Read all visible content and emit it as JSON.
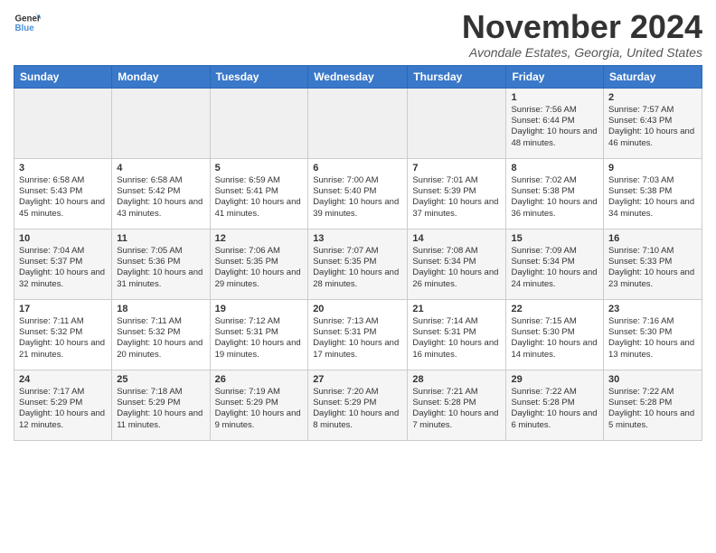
{
  "logo": {
    "line1": "General",
    "line2": "Blue"
  },
  "title": "November 2024",
  "location": "Avondale Estates, Georgia, United States",
  "days_header": [
    "Sunday",
    "Monday",
    "Tuesday",
    "Wednesday",
    "Thursday",
    "Friday",
    "Saturday"
  ],
  "weeks": [
    [
      {
        "day": "",
        "sunrise": "",
        "sunset": "",
        "daylight": ""
      },
      {
        "day": "",
        "sunrise": "",
        "sunset": "",
        "daylight": ""
      },
      {
        "day": "",
        "sunrise": "",
        "sunset": "",
        "daylight": ""
      },
      {
        "day": "",
        "sunrise": "",
        "sunset": "",
        "daylight": ""
      },
      {
        "day": "",
        "sunrise": "",
        "sunset": "",
        "daylight": ""
      },
      {
        "day": "1",
        "sunrise": "Sunrise: 7:56 AM",
        "sunset": "Sunset: 6:44 PM",
        "daylight": "Daylight: 10 hours and 48 minutes."
      },
      {
        "day": "2",
        "sunrise": "Sunrise: 7:57 AM",
        "sunset": "Sunset: 6:43 PM",
        "daylight": "Daylight: 10 hours and 46 minutes."
      }
    ],
    [
      {
        "day": "3",
        "sunrise": "Sunrise: 6:58 AM",
        "sunset": "Sunset: 5:43 PM",
        "daylight": "Daylight: 10 hours and 45 minutes."
      },
      {
        "day": "4",
        "sunrise": "Sunrise: 6:58 AM",
        "sunset": "Sunset: 5:42 PM",
        "daylight": "Daylight: 10 hours and 43 minutes."
      },
      {
        "day": "5",
        "sunrise": "Sunrise: 6:59 AM",
        "sunset": "Sunset: 5:41 PM",
        "daylight": "Daylight: 10 hours and 41 minutes."
      },
      {
        "day": "6",
        "sunrise": "Sunrise: 7:00 AM",
        "sunset": "Sunset: 5:40 PM",
        "daylight": "Daylight: 10 hours and 39 minutes."
      },
      {
        "day": "7",
        "sunrise": "Sunrise: 7:01 AM",
        "sunset": "Sunset: 5:39 PM",
        "daylight": "Daylight: 10 hours and 37 minutes."
      },
      {
        "day": "8",
        "sunrise": "Sunrise: 7:02 AM",
        "sunset": "Sunset: 5:38 PM",
        "daylight": "Daylight: 10 hours and 36 minutes."
      },
      {
        "day": "9",
        "sunrise": "Sunrise: 7:03 AM",
        "sunset": "Sunset: 5:38 PM",
        "daylight": "Daylight: 10 hours and 34 minutes."
      }
    ],
    [
      {
        "day": "10",
        "sunrise": "Sunrise: 7:04 AM",
        "sunset": "Sunset: 5:37 PM",
        "daylight": "Daylight: 10 hours and 32 minutes."
      },
      {
        "day": "11",
        "sunrise": "Sunrise: 7:05 AM",
        "sunset": "Sunset: 5:36 PM",
        "daylight": "Daylight: 10 hours and 31 minutes."
      },
      {
        "day": "12",
        "sunrise": "Sunrise: 7:06 AM",
        "sunset": "Sunset: 5:35 PM",
        "daylight": "Daylight: 10 hours and 29 minutes."
      },
      {
        "day": "13",
        "sunrise": "Sunrise: 7:07 AM",
        "sunset": "Sunset: 5:35 PM",
        "daylight": "Daylight: 10 hours and 28 minutes."
      },
      {
        "day": "14",
        "sunrise": "Sunrise: 7:08 AM",
        "sunset": "Sunset: 5:34 PM",
        "daylight": "Daylight: 10 hours and 26 minutes."
      },
      {
        "day": "15",
        "sunrise": "Sunrise: 7:09 AM",
        "sunset": "Sunset: 5:34 PM",
        "daylight": "Daylight: 10 hours and 24 minutes."
      },
      {
        "day": "16",
        "sunrise": "Sunrise: 7:10 AM",
        "sunset": "Sunset: 5:33 PM",
        "daylight": "Daylight: 10 hours and 23 minutes."
      }
    ],
    [
      {
        "day": "17",
        "sunrise": "Sunrise: 7:11 AM",
        "sunset": "Sunset: 5:32 PM",
        "daylight": "Daylight: 10 hours and 21 minutes."
      },
      {
        "day": "18",
        "sunrise": "Sunrise: 7:11 AM",
        "sunset": "Sunset: 5:32 PM",
        "daylight": "Daylight: 10 hours and 20 minutes."
      },
      {
        "day": "19",
        "sunrise": "Sunrise: 7:12 AM",
        "sunset": "Sunset: 5:31 PM",
        "daylight": "Daylight: 10 hours and 19 minutes."
      },
      {
        "day": "20",
        "sunrise": "Sunrise: 7:13 AM",
        "sunset": "Sunset: 5:31 PM",
        "daylight": "Daylight: 10 hours and 17 minutes."
      },
      {
        "day": "21",
        "sunrise": "Sunrise: 7:14 AM",
        "sunset": "Sunset: 5:31 PM",
        "daylight": "Daylight: 10 hours and 16 minutes."
      },
      {
        "day": "22",
        "sunrise": "Sunrise: 7:15 AM",
        "sunset": "Sunset: 5:30 PM",
        "daylight": "Daylight: 10 hours and 14 minutes."
      },
      {
        "day": "23",
        "sunrise": "Sunrise: 7:16 AM",
        "sunset": "Sunset: 5:30 PM",
        "daylight": "Daylight: 10 hours and 13 minutes."
      }
    ],
    [
      {
        "day": "24",
        "sunrise": "Sunrise: 7:17 AM",
        "sunset": "Sunset: 5:29 PM",
        "daylight": "Daylight: 10 hours and 12 minutes."
      },
      {
        "day": "25",
        "sunrise": "Sunrise: 7:18 AM",
        "sunset": "Sunset: 5:29 PM",
        "daylight": "Daylight: 10 hours and 11 minutes."
      },
      {
        "day": "26",
        "sunrise": "Sunrise: 7:19 AM",
        "sunset": "Sunset: 5:29 PM",
        "daylight": "Daylight: 10 hours and 9 minutes."
      },
      {
        "day": "27",
        "sunrise": "Sunrise: 7:20 AM",
        "sunset": "Sunset: 5:29 PM",
        "daylight": "Daylight: 10 hours and 8 minutes."
      },
      {
        "day": "28",
        "sunrise": "Sunrise: 7:21 AM",
        "sunset": "Sunset: 5:28 PM",
        "daylight": "Daylight: 10 hours and 7 minutes."
      },
      {
        "day": "29",
        "sunrise": "Sunrise: 7:22 AM",
        "sunset": "Sunset: 5:28 PM",
        "daylight": "Daylight: 10 hours and 6 minutes."
      },
      {
        "day": "30",
        "sunrise": "Sunrise: 7:22 AM",
        "sunset": "Sunset: 5:28 PM",
        "daylight": "Daylight: 10 hours and 5 minutes."
      }
    ]
  ]
}
